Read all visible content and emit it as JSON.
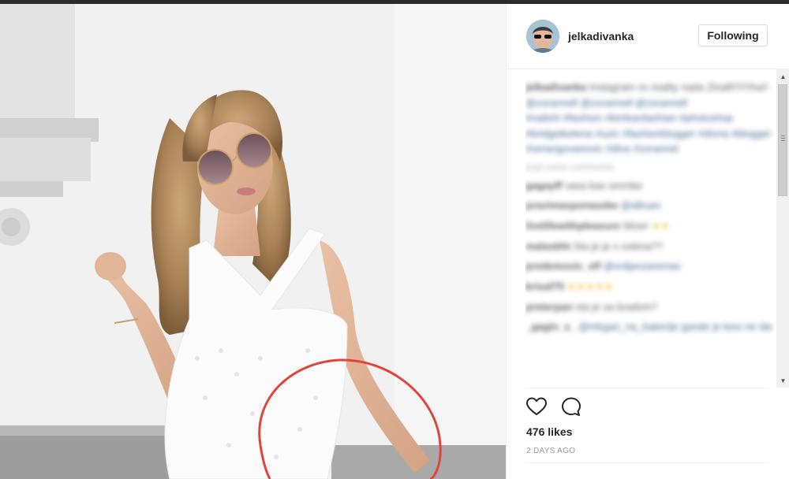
{
  "post": {
    "username": "jelkadivanka",
    "follow_label": "Following",
    "likes_label": "476 likes",
    "timestamp": "2 DAYS AGO"
  },
  "comments": {
    "caption": {
      "user": "jelkadivanka",
      "text": "Instagram vs reality nada Zinall!!!!!!!ha!!",
      "mentions": "@zorannell @zorannell @zorannell",
      "hashtags": "#nailshi #fashion #kimkardashian #photoshop #bridgetkelena #uzic #fashionblogger #divna #blogger #serangovanovic #diva #zorannel"
    },
    "load_more": "load more comments",
    "items": [
      {
        "user": "gagayff",
        "text": "vasa kao smrnke",
        "mention": "",
        "emoji": ""
      },
      {
        "user": "pravimasponaseke",
        "text": "",
        "mention": "@alksan",
        "emoji": ""
      },
      {
        "user": "livelifewithpleasure",
        "text": "Wow!",
        "mention": "",
        "emoji": "★★"
      },
      {
        "user": "malasbht",
        "text": "Sta je je s ostima??",
        "mention": "",
        "emoji": ""
      },
      {
        "user": "predemovic_elf",
        "text": "",
        "mention": "@srdjanzaremac",
        "emoji": ""
      },
      {
        "user": "krisaf75",
        "text": "",
        "mention": "",
        "emoji": "★★★★★"
      },
      {
        "user": "preterpan",
        "text": "sta je sa bradom?",
        "mention": "",
        "emoji": ""
      },
      {
        "user": "_gagin_s_",
        "text": "",
        "mention": "@mkgari_na_bakerije gande je kesi ne ide",
        "emoji": ""
      }
    ]
  },
  "icons": {
    "like": "heart-icon",
    "comment": "comment-bubble-icon",
    "scroll_up": "scroll-up-arrow-icon",
    "scroll_down": "scroll-down-arrow-icon"
  },
  "colors": {
    "text": "#262626",
    "muted": "#999999",
    "link": "#003569",
    "circle_annotation": "#e0453d"
  }
}
